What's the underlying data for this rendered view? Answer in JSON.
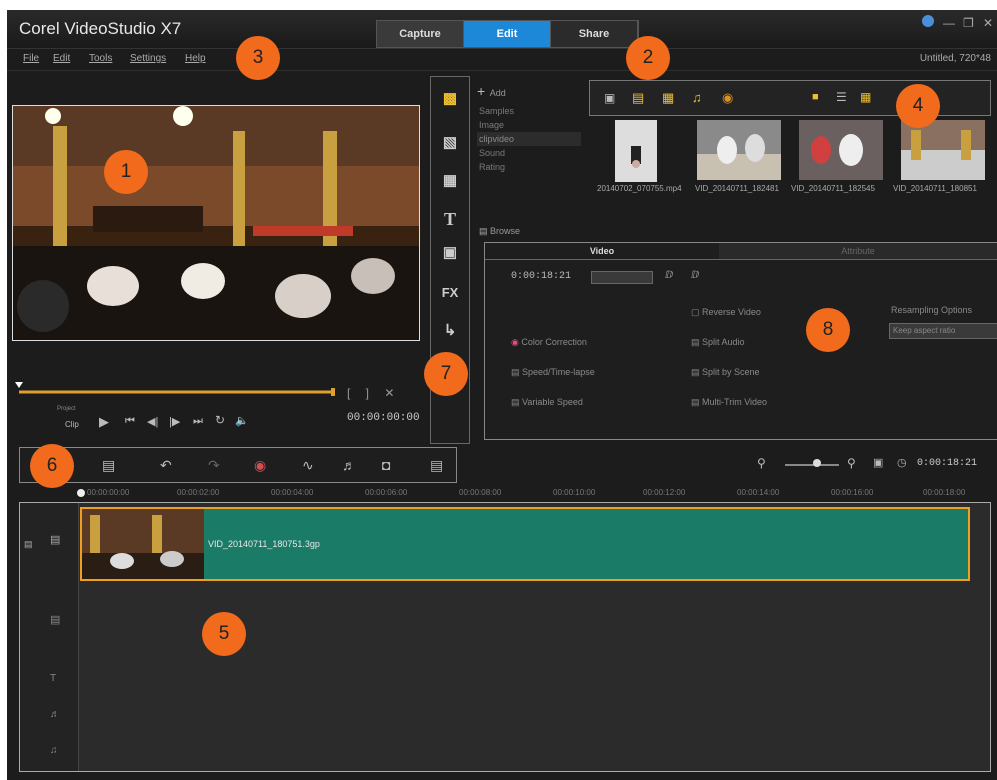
{
  "app": {
    "title": "Corel VideoStudio X7",
    "project": "Untitled, 720*48"
  },
  "mode_tabs": [
    "Capture",
    "Edit",
    "Share"
  ],
  "menus": [
    "File",
    "Edit",
    "Tools",
    "Settings",
    "Help"
  ],
  "callouts": [
    "1",
    "2",
    "3",
    "4",
    "5",
    "6",
    "7",
    "8"
  ],
  "player": {
    "project_label": "Project",
    "clip_label": "Clip",
    "timecode": "00:00:00:00"
  },
  "library": {
    "add_label": "Add",
    "folders": [
      "Samples",
      "Image",
      "clipvideo",
      "Sound",
      "Rating"
    ],
    "browse_label": "Browse",
    "thumbnails": [
      {
        "caption": "20140702_070755.mp4"
      },
      {
        "caption": "VID_20140711_182481"
      },
      {
        "caption": "VID_20140711_182545"
      },
      {
        "caption": "VID_20140711_180851"
      }
    ]
  },
  "options": {
    "tabs": [
      "Video",
      "Attribute"
    ],
    "duration": "0:00:18:21",
    "items_left": [
      "Color Correction",
      "Speed/Time-lapse",
      "Variable Speed"
    ],
    "items_mid": [
      "Reverse Video",
      "Split Audio",
      "Split by Scene",
      "Multi-Trim Video"
    ],
    "resampling_label": "Resampling Options",
    "resampling_value": "Keep aspect ratio"
  },
  "timeline": {
    "duration": "0:00:18:21",
    "ruler": [
      "00:00:00:00",
      "00:00:02:00",
      "00:00:04:00",
      "00:00:06:00",
      "00:00:08:00",
      "00:00:10:00",
      "00:00:12:00",
      "00:00:14:00",
      "00:00:16:00",
      "00:00:18:00"
    ],
    "clip_label": "VID_20140711_180751.3gp"
  }
}
